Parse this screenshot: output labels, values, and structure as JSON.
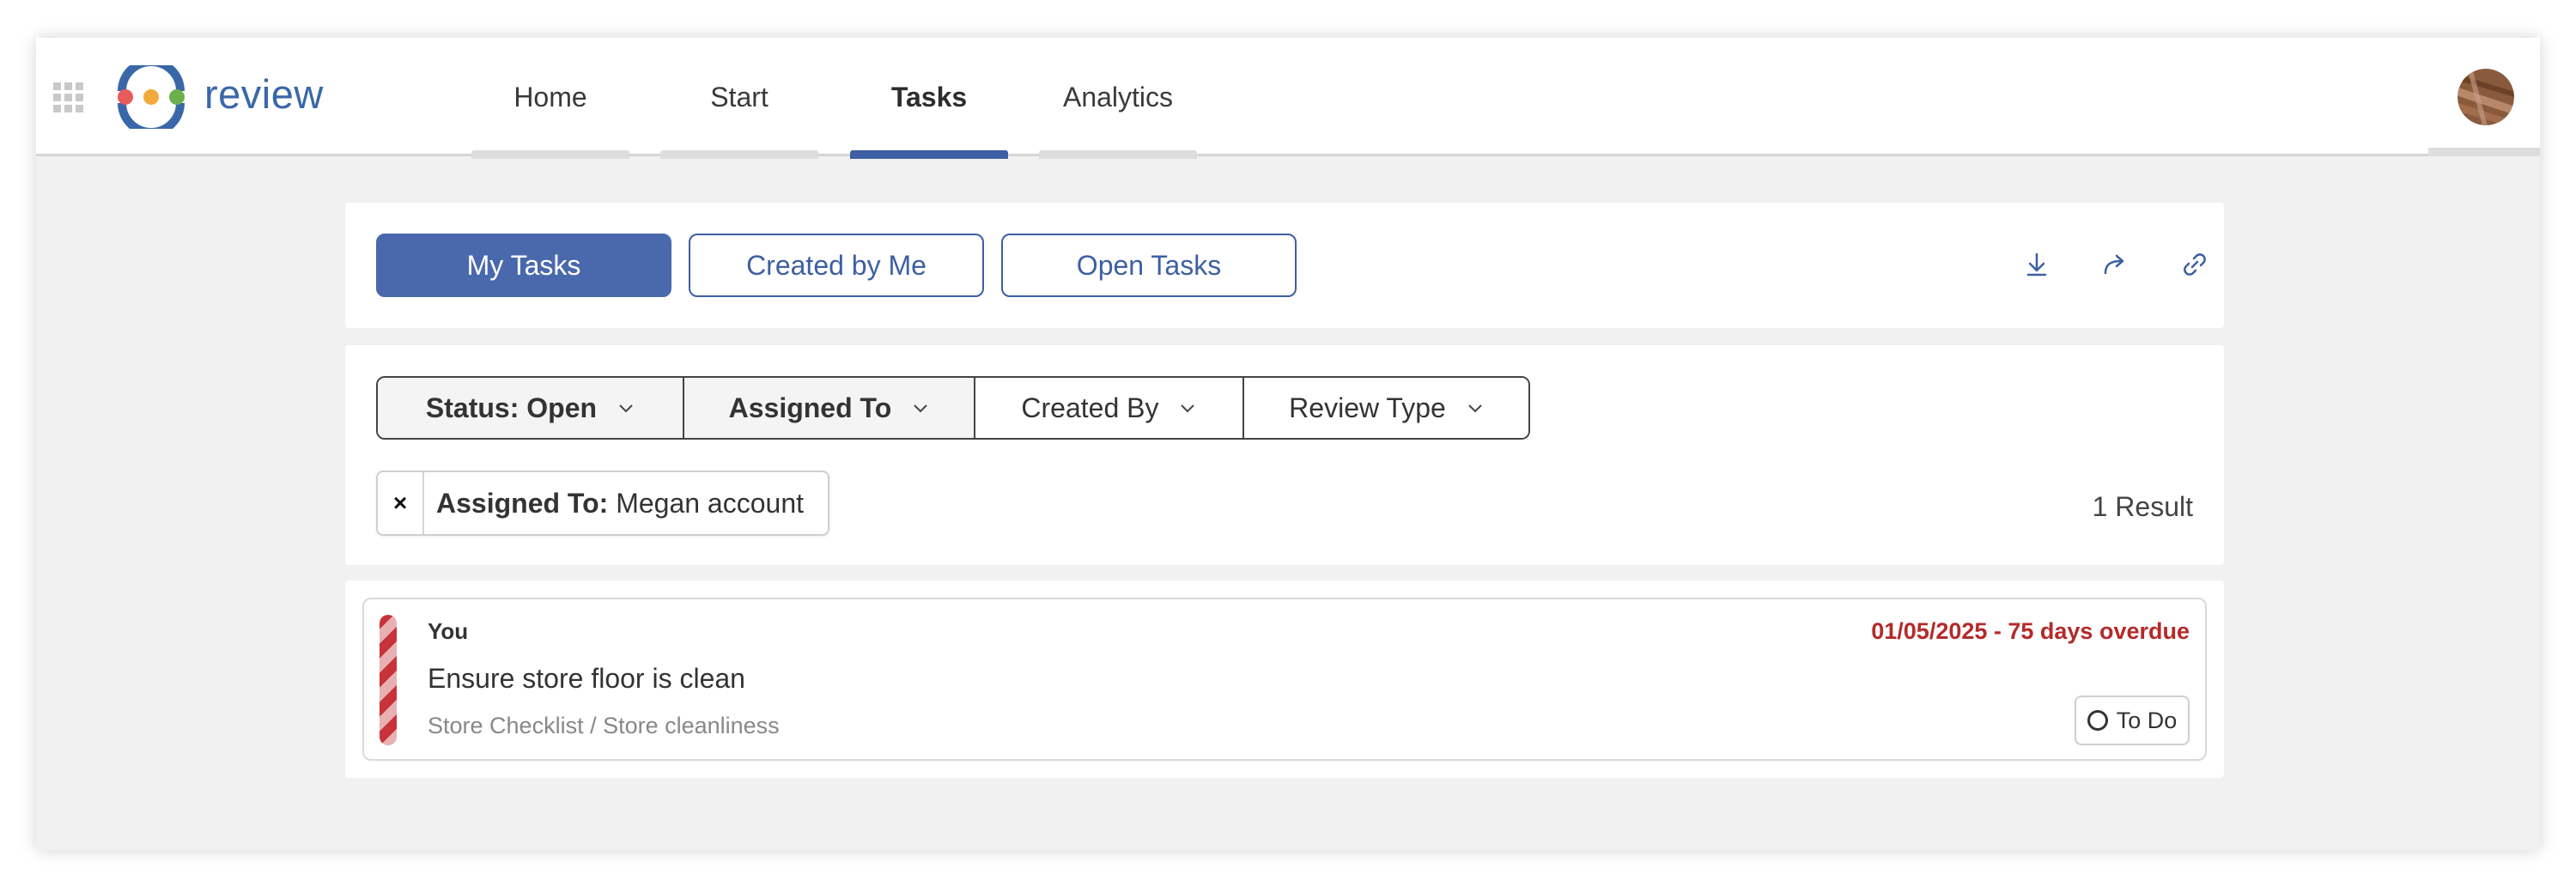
{
  "app": {
    "brand": "review",
    "brand_color": "#3a67a8",
    "accent_color": "#3d5fa3",
    "overdue_color": "#b42a2a"
  },
  "header": {
    "apps_icon": "grid-apps-icon",
    "logo_icon": "review-logo-icon",
    "nav": [
      {
        "label": "Home",
        "active": false
      },
      {
        "label": "Start",
        "active": false
      },
      {
        "label": "Tasks",
        "active": true
      },
      {
        "label": "Analytics",
        "active": false
      }
    ],
    "avatar_icon": "user-avatar"
  },
  "views": {
    "tabs": [
      {
        "label": "My Tasks",
        "active": true
      },
      {
        "label": "Created by Me",
        "active": false
      },
      {
        "label": "Open Tasks",
        "active": false
      }
    ],
    "tools": [
      "download-icon",
      "share-icon",
      "link-icon"
    ]
  },
  "filters": {
    "items": [
      {
        "label": "Status: Open",
        "active": true
      },
      {
        "label": "Assigned To",
        "active": true
      },
      {
        "label": "Created By",
        "active": false
      },
      {
        "label": "Review Type",
        "active": false
      }
    ],
    "chip": {
      "remove_label": "×",
      "key": "Assigned To:",
      "value": "Megan account"
    },
    "result_count": "1 Result"
  },
  "tasks": [
    {
      "assignee": "You",
      "due": "01/05/2025 - 75 days overdue",
      "title": "Ensure store floor is clean",
      "path": "Store Checklist / Store cleanliness",
      "status": "To Do"
    }
  ]
}
